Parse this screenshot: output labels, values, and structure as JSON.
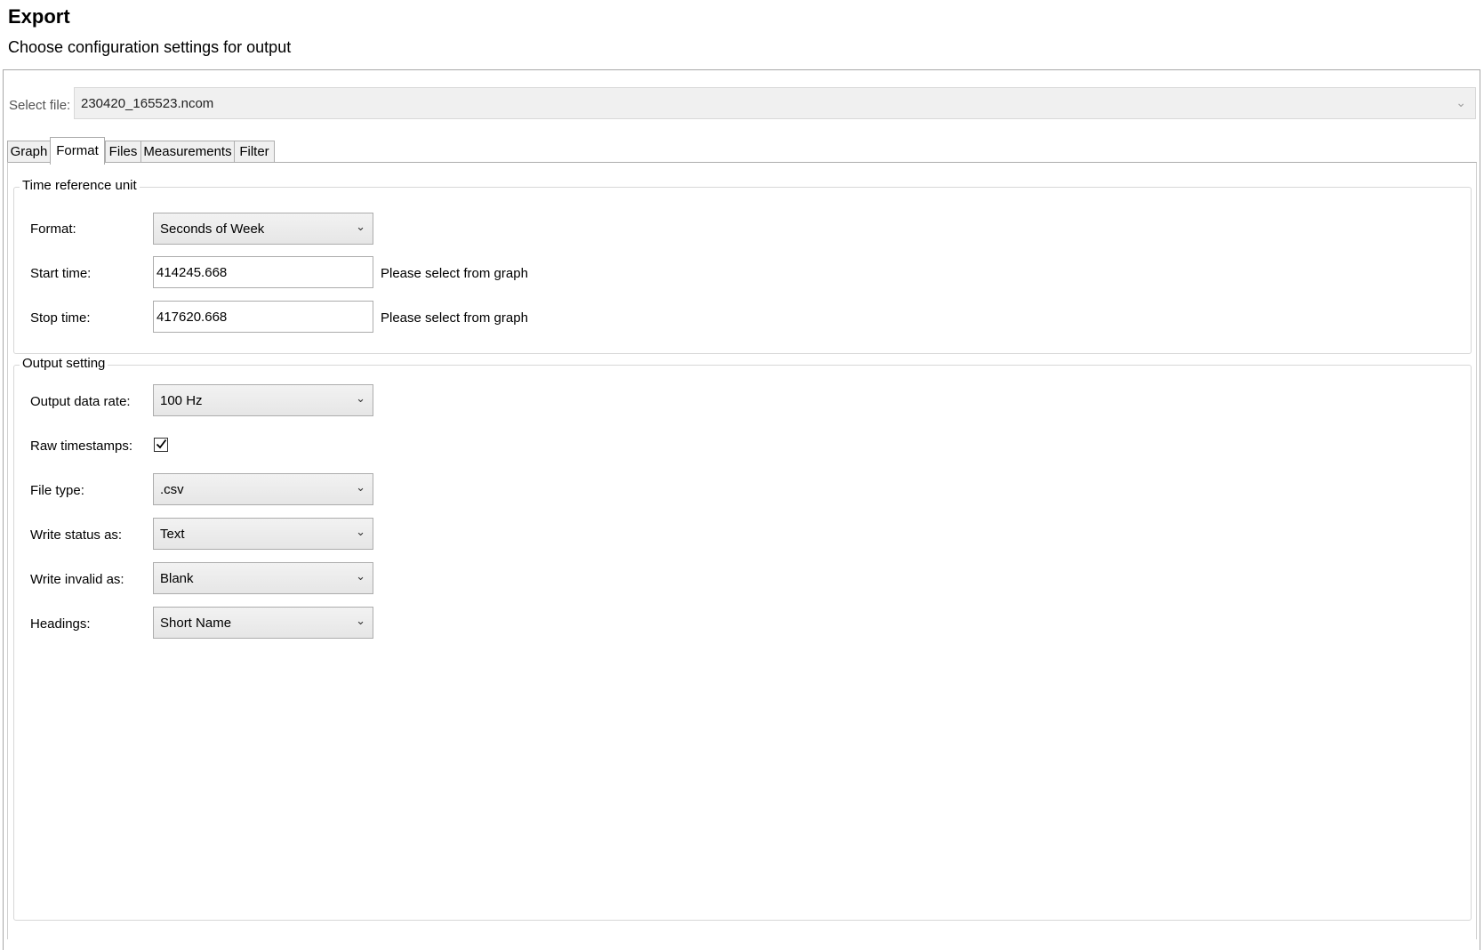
{
  "header": {
    "title": "Export",
    "subtitle": "Choose configuration settings for output"
  },
  "file": {
    "label": "Select file:",
    "value": "230420_165523.ncom"
  },
  "tabs": [
    {
      "label": "Graph",
      "active": false
    },
    {
      "label": "Format",
      "active": true
    },
    {
      "label": "Files",
      "active": false
    },
    {
      "label": "Measurements",
      "active": false
    },
    {
      "label": "Filter",
      "active": false
    }
  ],
  "time_reference": {
    "legend": "Time reference unit",
    "format_label": "Format:",
    "format_value": "Seconds of Week",
    "start_label": "Start time:",
    "start_value": "414245.668",
    "start_hint": "Please select from graph",
    "stop_label": "Stop time:",
    "stop_value": "417620.668",
    "stop_hint": "Please select from graph"
  },
  "output_setting": {
    "legend": "Output setting",
    "rate_label": "Output data rate:",
    "rate_value": "100 Hz",
    "raw_label": "Raw timestamps:",
    "raw_checked": true,
    "filetype_label": "File type:",
    "filetype_value": ".csv",
    "status_label": "Write status as:",
    "status_value": "Text",
    "invalid_label": "Write invalid as:",
    "invalid_value": "Blank",
    "headings_label": "Headings:",
    "headings_value": "Short Name"
  },
  "icons": {
    "dropdown": "chevron-down-icon",
    "check": "checkmark-icon"
  }
}
